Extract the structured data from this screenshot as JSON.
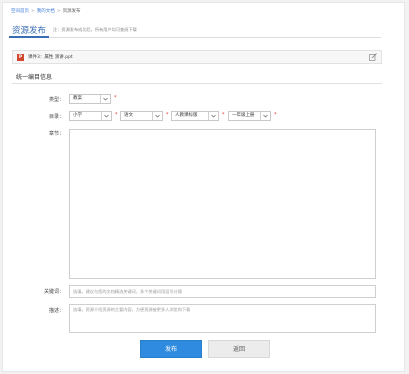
{
  "breadcrumb": {
    "items": [
      "空间首页",
      "我的文档"
    ],
    "current": "资源发布",
    "separator": ">"
  },
  "header": {
    "title": "资源发布",
    "note": "注：资源发布成功后，所有用户均可查阅下载"
  },
  "file": {
    "icon_label": "P",
    "name": "课件3：属性 演讲.ppt"
  },
  "section": {
    "title": "统一编目信息"
  },
  "form": {
    "type": {
      "label": "类型：",
      "value": "教案"
    },
    "catalog": {
      "label": "目录：",
      "stage": "小学",
      "subject": "语文",
      "edition": "人教课标版",
      "grade": "一年级上册"
    },
    "chapter": {
      "label": "章节："
    },
    "keywords": {
      "label": "关键词：",
      "placeholder": "选填，建议与您的文档精选关键词，多个关键词用逗号分隔"
    },
    "description": {
      "label": "描述：",
      "placeholder": "选填，资源介绍资源的主要内容，方便资源被更多人浏览和下载"
    },
    "required_mark": "*"
  },
  "buttons": {
    "publish": "发布",
    "back": "返回"
  },
  "colors": {
    "accent": "#2f8be0",
    "title": "#3b6db5",
    "required": "#e0372b"
  }
}
